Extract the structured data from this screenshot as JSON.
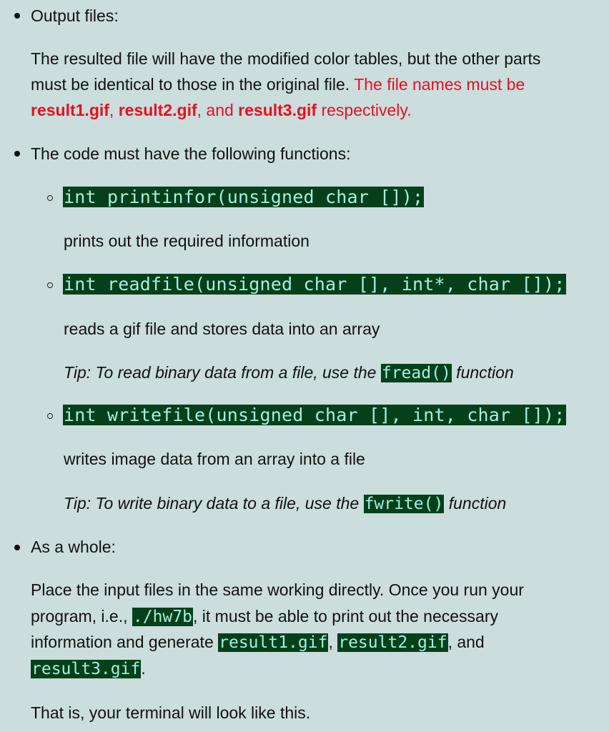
{
  "output_files": {
    "heading": "Output files:",
    "para_line1": "The resulted file will have the modified color tables, but the other parts",
    "para_line2_black": "must be identical to those in the original file. ",
    "para_line2_red": "The file names must be",
    "names": [
      "result1.gif",
      "result2.gif",
      "result3.gif"
    ],
    "sep1": ", ",
    "sep2": ", and ",
    "tail": " respectively."
  },
  "functions": {
    "heading": "The code must have the following functions:",
    "items": [
      {
        "signature": "int printinfor(unsigned char []);",
        "description": "prints out the required information"
      },
      {
        "signature": "int readfile(unsigned char [], int*, char []);",
        "description": "reads a gif file and stores data into an array",
        "tip_before": "Tip: To read binary data from a file, use the ",
        "tip_code": "fread()",
        "tip_after": " function"
      },
      {
        "signature": "int writefile(unsigned char [], int, char []);",
        "description": "writes image data from an array into a file",
        "tip_before": "Tip: To write binary data to a file, use the ",
        "tip_code": "fwrite()",
        "tip_after": " function"
      }
    ]
  },
  "as_a_whole": {
    "heading": "As a whole:",
    "line1": "Place the input files in the same working directly. Once you run your",
    "line2_before": "program, i.e., ",
    "line2_code": "./hw7b",
    "line2_after": ", it must be able to print out the necessary",
    "line3_before": "information and generate ",
    "code1": "result1.gif",
    "sep1": ", ",
    "code2": "result2.gif",
    "sep2": ", and",
    "code3": "result3.gif",
    "line4_after": ".",
    "closing": "That is, your terminal will look like this."
  },
  "colors": {
    "background": "#cbdddd",
    "text": "#111111",
    "accent_red": "#e8101e",
    "code_bg": "#05401a",
    "code_fg": "#a3f0e0"
  }
}
